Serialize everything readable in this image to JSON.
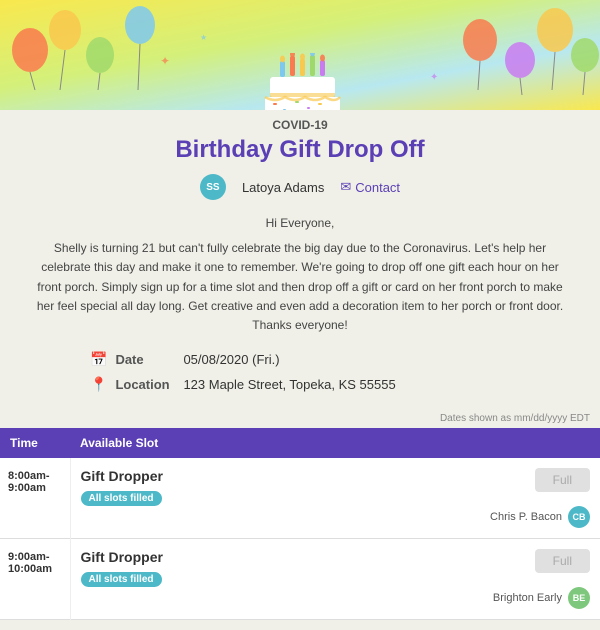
{
  "banner": {
    "alt": "Birthday party banner with balloons"
  },
  "covid_label": "COVID-19",
  "event_title": "Birthday Gift Drop Off",
  "organizer": {
    "initials": "SS",
    "name": "Latoya Adams",
    "contact_label": "Contact"
  },
  "description": {
    "greeting": "Hi Everyone,",
    "body": "Shelly is turning 21 but can't fully celebrate the big day due to the Coronavirus. Let's help her celebrate this day and make it one to remember. We're going to drop off one gift each hour on her front porch. Simply sign up for a time slot and then drop off a gift or card on her front porch to make her feel special all day long. Get creative and even add a decoration item to her porch or front door. Thanks everyone!"
  },
  "details": {
    "date_label": "Date",
    "date_value": "05/08/2020 (Fri.)",
    "location_label": "Location",
    "location_value": "123 Maple Street, Topeka, KS 55555"
  },
  "slots": {
    "timezone_note": "Dates shown as mm/dd/yyyy EDT",
    "header_time": "Time",
    "header_slot": "Available Slot",
    "rows": [
      {
        "time": "8:00am-\n9:00am",
        "slot_name": "Gift Dropper",
        "badge": "All slots filled",
        "btn_label": "Full",
        "assignee_name": "Chris P. Bacon",
        "assignee_initials": "CB",
        "avatar_class": "avatar-cb"
      },
      {
        "time": "9:00am-\n10:00am",
        "slot_name": "Gift Dropper",
        "badge": "All slots filled",
        "btn_label": "Full",
        "assignee_name": "Brighton Early",
        "assignee_initials": "BE",
        "avatar_class": "avatar-be"
      }
    ]
  }
}
